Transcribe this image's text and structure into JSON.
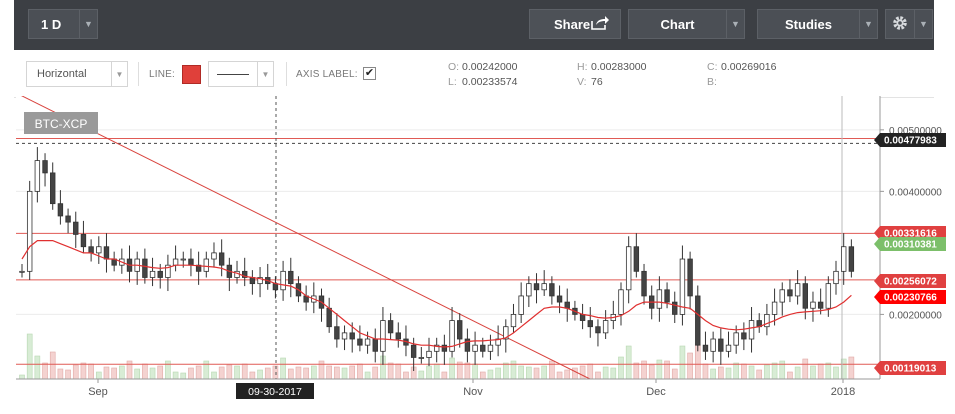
{
  "toolbar": {
    "period": "1 D",
    "share": "Share",
    "chart": "Chart",
    "studies": "Studies"
  },
  "drawbar": {
    "tool": "Horizontal",
    "line_label": "LINE:",
    "line_color": "#e0403a",
    "axis_label": "AXIS LABEL:",
    "axis_label_checked": true,
    "ohlc": {
      "O": "0.00242000",
      "H": "0.00283000",
      "C": "0.00269016",
      "L": "0.00233574",
      "V": "76",
      "B": ""
    }
  },
  "chart_data": {
    "type": "candlestick",
    "symbol_label": "BTC-XCP",
    "x_ticks": [
      "Sep",
      "Nov",
      "Dec",
      "2018"
    ],
    "crosshair_date": "09-30-2017",
    "y_ticks": [
      "0.00500000",
      "0.00400000",
      "0.00200000"
    ],
    "ylim": [
      0.00095,
      0.00555
    ],
    "price_tags": [
      {
        "value": "0.00477983",
        "color": "#222222"
      },
      {
        "value": "0.00331616",
        "color": "#e04040"
      },
      {
        "value": "0.00310381",
        "color": "#7cbf6a"
      },
      {
        "value": "0.00256072",
        "color": "#e04040"
      },
      {
        "value": "0.00230766",
        "color": "#ff0000"
      },
      {
        "value": "0.00119013",
        "color": "#e04040"
      }
    ],
    "horizontal_lines": [
      0.00486,
      0.00331616,
      0.00256072,
      0.00119013
    ],
    "close": [
      0.0027,
      0.004,
      0.0045,
      0.0043,
      0.0038,
      0.0036,
      0.0035,
      0.0033,
      0.0031,
      0.003,
      0.0031,
      0.0029,
      0.0028,
      0.0029,
      0.0027,
      0.0029,
      0.0026,
      0.0027,
      0.0026,
      0.0028,
      0.0029,
      0.0029,
      0.0028,
      0.0027,
      0.0029,
      0.003,
      0.0028,
      0.0026,
      0.0027,
      0.0026,
      0.0025,
      0.0026,
      0.0025,
      0.0024,
      0.0027,
      0.0025,
      0.0023,
      0.0022,
      0.0023,
      0.0021,
      0.0018,
      0.0016,
      0.0017,
      0.0016,
      0.0015,
      0.0016,
      0.0014,
      0.0019,
      0.0017,
      0.0016,
      0.0015,
      0.0013,
      0.0013,
      0.0014,
      0.0015,
      0.0014,
      0.0019,
      0.0016,
      0.0014,
      0.0015,
      0.0014,
      0.0015,
      0.0016,
      0.0018,
      0.002,
      0.0023,
      0.0025,
      0.0024,
      0.0025,
      0.0023,
      0.0022,
      0.0021,
      0.002,
      0.0019,
      0.0018,
      0.0017,
      0.0019,
      0.002,
      0.0024,
      0.0031,
      0.0027,
      0.0023,
      0.0021,
      0.0024,
      0.0022,
      0.002,
      0.0029,
      0.0023,
      0.0015,
      0.0014,
      0.0016,
      0.0014,
      0.0015,
      0.0017,
      0.0016,
      0.0019,
      0.0018,
      0.002,
      0.0022,
      0.0024,
      0.0023,
      0.0025,
      0.0021,
      0.0022,
      0.0021,
      0.0025,
      0.0027,
      0.0031,
      0.0027
    ],
    "moving_average": [
      0.0029,
      0.0031,
      0.0032,
      0.0032,
      0.0032,
      0.00315,
      0.0031,
      0.00305,
      0.003,
      0.003,
      0.00295,
      0.0029,
      0.0029,
      0.00285,
      0.0028,
      0.0028,
      0.00278,
      0.00276,
      0.00275,
      0.00276,
      0.0028,
      0.0028,
      0.0028,
      0.00279,
      0.00278,
      0.00277,
      0.00275,
      0.0027,
      0.00267,
      0.00262,
      0.0026,
      0.00258,
      0.00255,
      0.0025,
      0.00248,
      0.00246,
      0.0024,
      0.0023,
      0.00225,
      0.0022,
      0.0021,
      0.002,
      0.0019,
      0.0018,
      0.0017,
      0.00165,
      0.0016,
      0.0016,
      0.00159,
      0.00158,
      0.00156,
      0.00152,
      0.0015,
      0.0015,
      0.00148,
      0.00147,
      0.00148,
      0.00152,
      0.00156,
      0.00157,
      0.00157,
      0.00158,
      0.00159,
      0.00162,
      0.0017,
      0.0018,
      0.0019,
      0.002,
      0.0021,
      0.00212,
      0.00212,
      0.0021,
      0.00205,
      0.002,
      0.00198,
      0.00195,
      0.00194,
      0.00195,
      0.00198,
      0.00205,
      0.00215,
      0.0022,
      0.0022,
      0.0022,
      0.00218,
      0.00215,
      0.00212,
      0.0021,
      0.002,
      0.0019,
      0.00182,
      0.00178,
      0.00176,
      0.00175,
      0.00176,
      0.00178,
      0.0018,
      0.00185,
      0.0019,
      0.00196,
      0.002,
      0.00203,
      0.00204,
      0.00205,
      0.00206,
      0.00208,
      0.00212,
      0.0022,
      0.00231
    ]
  }
}
